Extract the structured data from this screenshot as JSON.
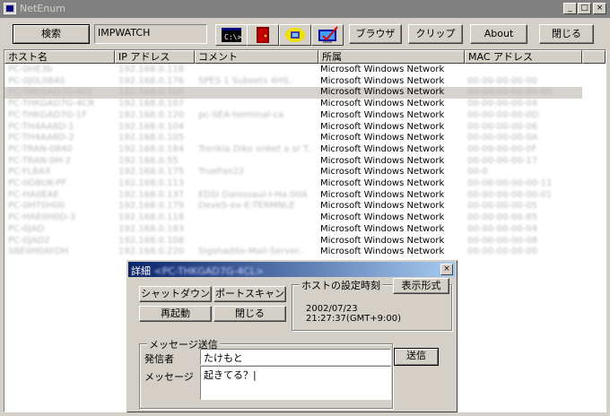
{
  "window": {
    "title": "NetEnum"
  },
  "toolbar": {
    "search_label": "検索",
    "workgroup_value": "IMPWATCH",
    "browser_label": "ブラウザ",
    "clip_label": "クリップ",
    "about_label": "About",
    "close_label": "閉じる",
    "icons": [
      "cmd-prompt-icon",
      "door-exit-icon",
      "network-share-icon",
      "monitor-check-icon"
    ]
  },
  "list": {
    "columns": [
      "ホスト名",
      "IP アドレス",
      "コメント",
      "所属",
      "MAC アドレス"
    ],
    "rows": [
      {
        "host": "PC-0HE3b",
        "ip": "192.168.0.118",
        "comment": "",
        "workgroup": "Microsoft Windows Network",
        "mac": ""
      },
      {
        "host": "PC-0J0L0840",
        "ip": "192.168.0.176",
        "comment": "SPES 1 Subsets 4HS..",
        "workgroup": "Microsoft Windows Network",
        "mac": "00-00-00-00-00"
      },
      {
        "host": "PC-THKGAD7G-4CL",
        "ip": "192.168.0.106",
        "comment": "",
        "workgroup": "Microsoft Windows Network",
        "mac": "00-00-00-00-00-00"
      },
      {
        "host": "PC-THKGAD7G-4CR",
        "ip": "192.168.0.107",
        "comment": "",
        "workgroup": "Microsoft Windows Network",
        "mac": "00-00-00-00-04"
      },
      {
        "host": "PC-THKGAD7G-1F",
        "ip": "192.168.0.120",
        "comment": "pc-SEA-terminal-ca",
        "workgroup": "Microsoft Windows Network",
        "mac": "00-00-00-00-0D"
      },
      {
        "host": "PC-TH4AA8D-1",
        "ip": "192.168.0.104",
        "comment": "",
        "workgroup": "Microsoft Windows Network",
        "mac": "00-00-00-00-06"
      },
      {
        "host": "PC-TH4AA8D-2",
        "ip": "192.168.0.105",
        "comment": "",
        "workgroup": "Microsoft Windows Network",
        "mac": "00-00-00-00-0A"
      },
      {
        "host": "PC-TRAN-0840",
        "ip": "192.168.0.184",
        "comment": "Trenkla Diko onket a sr T..",
        "workgroup": "Microsoft Windows Network",
        "mac": "00-00-00-00-0F"
      },
      {
        "host": "PC-TRAN-0H-2",
        "ip": "192.168.0.55",
        "comment": "",
        "workgroup": "Microsoft Windows Network",
        "mac": "00-00-00-00-17"
      },
      {
        "host": "PC-YLBAX",
        "ip": "192.168.0.175",
        "comment": "TrueFan22",
        "workgroup": "Microsoft Windows Network",
        "mac": "00-0"
      },
      {
        "host": "PC-0D8UK-PF",
        "ip": "192.168.0.113",
        "comment": "",
        "workgroup": "Microsoft Windows Network",
        "mac": "00-00-00-00-00-11"
      },
      {
        "host": "PC-HA0EAE",
        "ip": "192.168.0.137",
        "comment": "EDSI Danissaul-I-Ha.00A",
        "workgroup": "Microsoft Windows Network",
        "mac": "00-00-00-00-00-01"
      },
      {
        "host": "PC-0HT0H00",
        "ip": "192.168.0.179",
        "comment": "DeveS-ex-E-TERMNLE",
        "workgroup": "Microsoft Windows Network",
        "mac": "00-00-00-00-05"
      },
      {
        "host": "PC-HAE0H0D-3",
        "ip": "192.168.0.118",
        "comment": "",
        "workgroup": "Microsoft Windows Network",
        "mac": "00-00-00-00-85"
      },
      {
        "host": "PC-0JAD",
        "ip": "192.168.0.183",
        "comment": "",
        "workgroup": "Microsoft Windows Network",
        "mac": "00-00-00-00-04"
      },
      {
        "host": "PC-0JAD2",
        "ip": "192.168.0.108",
        "comment": "",
        "workgroup": "Microsoft Windows Network",
        "mac": "00-00-00-00-08"
      },
      {
        "host": "SBE0H0AYDH",
        "ip": "192.168.0.220",
        "comment": "Sigshadite-Mail-Server..",
        "workgroup": "Microsoft Windows Network",
        "mac": "00-00-00-00-00"
      }
    ]
  },
  "dialog": {
    "title": "詳細",
    "title_target": "<PC-THKGAD7G-4CL>",
    "shutdown_label": "シャットダウン",
    "portscan_label": "ポートスキャン",
    "reboot_label": "再起動",
    "close_label": "閉じる",
    "host_time_legend": "ホストの設定時刻",
    "display_format_label": "表示形式",
    "host_time_value": "2002/07/23  21:27:37(GMT+9:00)",
    "message_legend": "メッセージ送信",
    "sender_label": "発信者",
    "sender_value": "たけもと",
    "message_label": "メッセージ",
    "message_value": "起きてる？|",
    "send_label": "送信"
  }
}
